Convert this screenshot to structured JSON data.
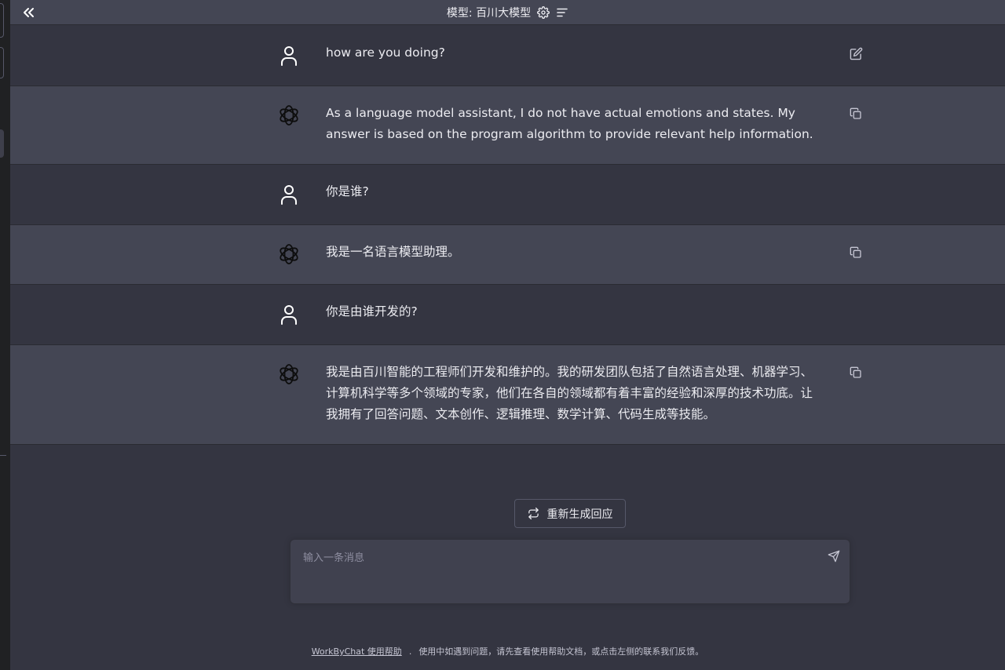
{
  "header": {
    "model_label": "模型: 百川大模型"
  },
  "messages": [
    {
      "role": "user",
      "text": "how are you doing?"
    },
    {
      "role": "assistant",
      "text": "As a language model assistant, I do not have actual emotions and states. My answer is based on the program algorithm to provide relevant help information."
    },
    {
      "role": "user",
      "text": "你是谁?"
    },
    {
      "role": "assistant",
      "text": "我是一名语言模型助理。"
    },
    {
      "role": "user",
      "text": "你是由谁开发的?"
    },
    {
      "role": "assistant",
      "text": "我是由百川智能的工程师们开发和维护的。我的研发团队包括了自然语言处理、机器学习、计算机科学等多个领域的专家，他们在各自的领域都有着丰富的经验和深厚的技术功底。让我拥有了回答问题、文本创作、逻辑推理、数学计算、代码生成等技能。"
    }
  ],
  "regenerate_label": "重新生成回应",
  "composer": {
    "placeholder": "输入一条消息"
  },
  "footer": {
    "help_link": "WorkByChat 使用帮助",
    "separator": ".",
    "note": "使用中如遇到问题，请先查看使用帮助文档，或点击左侧的联系我们反馈。"
  },
  "icons": {
    "collapse": "double-chevron-left-icon",
    "settings": "gear-icon",
    "menu": "menu-lines-icon",
    "user_avatar": "user-icon",
    "bot_avatar": "openai-logo-icon",
    "edit": "edit-icon",
    "copy": "copy-icon",
    "regenerate": "refresh-icon",
    "send": "send-icon"
  }
}
